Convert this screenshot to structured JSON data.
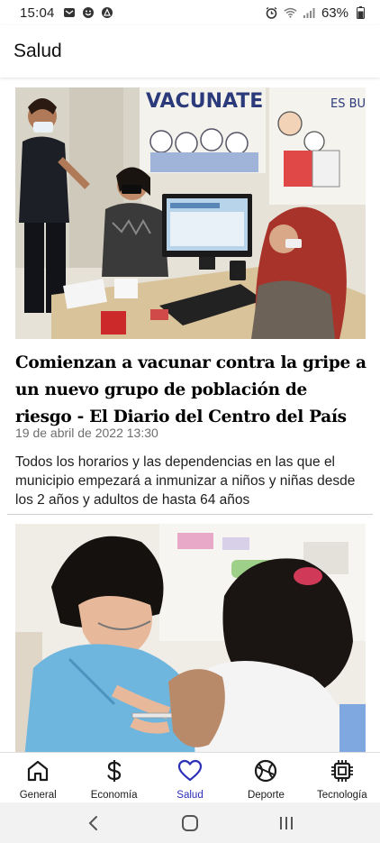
{
  "status_bar": {
    "time": "15:04",
    "battery": "63%",
    "left_icons": [
      "message-icon",
      "face-icon",
      "warning-icon"
    ],
    "right_icons": [
      "alarm-icon",
      "wifi-icon",
      "signal-icon",
      "battery-icon"
    ]
  },
  "app_bar": {
    "title": "Salud"
  },
  "articles": [
    {
      "headline": "Comienzan a vacunar contra la gripe a un nuevo grupo de población de riesgo - El Diario del Centro del País",
      "date": "19 de abril de 2022 13:30",
      "summary": "Todos los horarios y las dependencias en las que el municipio empezará a inmunizar a niños y niñas desde los 2 años y adultos de hasta 64 años",
      "image_sign_text": "VACUNATE",
      "image_poster_text": "ES BUE"
    },
    {
      "headline": "",
      "date": "",
      "summary": ""
    }
  ],
  "bottom_nav": {
    "items": [
      {
        "label": "General",
        "icon": "home-icon",
        "active": false
      },
      {
        "label": "Economía",
        "icon": "dollar-icon",
        "active": false
      },
      {
        "label": "Salud",
        "icon": "heart-icon",
        "active": true
      },
      {
        "label": "Deporte",
        "icon": "ball-icon",
        "active": false
      },
      {
        "label": "Tecnología",
        "icon": "chip-icon",
        "active": false
      }
    ],
    "active_color": "#2b2fb8"
  },
  "system_nav": [
    "back-icon",
    "home-circle-icon",
    "recents-icon"
  ]
}
